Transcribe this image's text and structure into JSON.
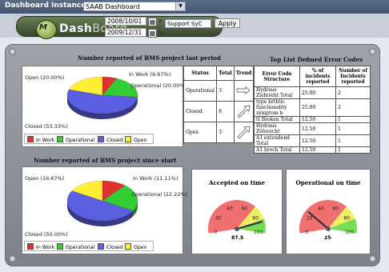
{
  "topbar": {
    "instance_label": "Dashboard Instance:",
    "instance_value": "SAAB Dashboard"
  },
  "logo": {
    "dash": "Dash",
    "board": "Board"
  },
  "filters": {
    "date_from": "2008/10/01",
    "date_to": "2009/12/31",
    "support": "Support SyC",
    "apply_label": "Apply"
  },
  "period_chart": {
    "title": "Number reported of BMS project last period",
    "labels": {
      "in_work": "In Work (6.67%)",
      "operational": "Operational (20.00%)",
      "open": "Open (20.00%)",
      "closed": "Closed (53.33%)"
    }
  },
  "since_chart": {
    "title": "Number reported of BMS project since start",
    "labels": {
      "in_work": "In Work (11.11%)",
      "operational": "Operational (22.22%)",
      "open": "Open (16.67%)",
      "closed": "Closed (50.00%)"
    }
  },
  "legend": {
    "in_work": "In Work",
    "operational": "Operational",
    "closed": "Closed",
    "open": "Open"
  },
  "colors": {
    "in_work": "#e03030",
    "operational": "#33cc33",
    "closed": "#5a5ee0",
    "open": "#ffee33"
  },
  "status_table": {
    "headers": [
      "Status",
      "Total",
      "Trend"
    ],
    "rows": [
      {
        "status": "Operational",
        "total": "3"
      },
      {
        "status": "Closed",
        "total": "8"
      },
      {
        "status": "Open",
        "total": "3"
      }
    ]
  },
  "errors": {
    "title": "Top List Defined Error Codes",
    "headers": [
      "Error Code Structure",
      "% of incidents reported",
      "Number of Incidents reported"
    ],
    "rows": [
      {
        "code": "Hydraus Ziefereht Total",
        "pct": "25.00",
        "num": "2"
      },
      {
        "code": "type brthtic functionality symptom b",
        "pct": "25.00",
        "num": "2"
      },
      {
        "code": "tt Broken Total",
        "pct": "12.50",
        "num": "1"
      },
      {
        "code": "Hydraus Zeferecht",
        "pct": "12.50",
        "num": "1"
      },
      {
        "code": "A1 extendend Total",
        "pct": "12.50",
        "num": "1"
      },
      {
        "code": "A1 broch Total",
        "pct": "12.50",
        "num": "1"
      }
    ]
  },
  "gauges": {
    "accepted": {
      "title": "Accepted on time",
      "value": "87.5",
      "ticks": [
        "0",
        "20",
        "40",
        "60",
        "80",
        "100"
      ]
    },
    "operational": {
      "title": "Operational on time",
      "value": "25",
      "ticks": [
        "0",
        "20",
        "40",
        "60",
        "80",
        "100"
      ]
    }
  },
  "chart_data": [
    {
      "type": "pie",
      "title": "Number reported of BMS project last period",
      "categories": [
        "In Work",
        "Operational",
        "Closed",
        "Open"
      ],
      "values": [
        6.67,
        20.0,
        53.33,
        20.0
      ]
    },
    {
      "type": "pie",
      "title": "Number reported of BMS project since start",
      "categories": [
        "In Work",
        "Operational",
        "Closed",
        "Open"
      ],
      "values": [
        11.11,
        22.22,
        50.0,
        16.67
      ]
    }
  ]
}
